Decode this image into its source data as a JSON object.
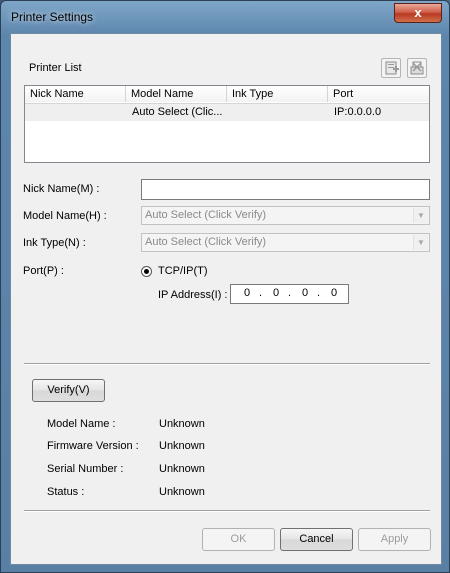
{
  "window": {
    "title": "Printer Settings",
    "close_glyph": "x"
  },
  "printer_list": {
    "label": "Printer List",
    "columns": [
      "Nick Name",
      "Model Name",
      "Ink Type",
      "Port"
    ],
    "rows": [
      {
        "nick_name": "",
        "model_name": "Auto Select (Clic...",
        "ink_type": "",
        "port": "IP:0.0.0.0"
      }
    ],
    "icons": [
      "add-printer-icon",
      "delete-printer-icon"
    ]
  },
  "form": {
    "nick_name_label": "Nick Name(M) :",
    "nick_name_value": "",
    "model_name_label": "Model Name(H) :",
    "model_name_value": "Auto Select (Click Verify)",
    "ink_type_label": "Ink Type(N) :",
    "ink_type_value": "Auto Select (Click Verify)",
    "port_label": "Port(P) :",
    "port_option": "TCP/IP(T)",
    "ip_label": "IP Address(I) :",
    "ip_octets": [
      "0",
      "0",
      "0",
      "0"
    ]
  },
  "verify": {
    "button_label": "Verify(V)",
    "info": [
      {
        "label": "Model Name :",
        "value": "Unknown"
      },
      {
        "label": "Firmware Version :",
        "value": "Unknown"
      },
      {
        "label": "Serial Number :",
        "value": "Unknown"
      },
      {
        "label": "Status :",
        "value": "Unknown"
      }
    ]
  },
  "buttons": {
    "ok": "OK",
    "cancel": "Cancel",
    "apply": "Apply"
  },
  "colors": {
    "titlebar": "#5d86ad",
    "close": "#c6452d",
    "dialog_bg": "#f0f0f0"
  }
}
